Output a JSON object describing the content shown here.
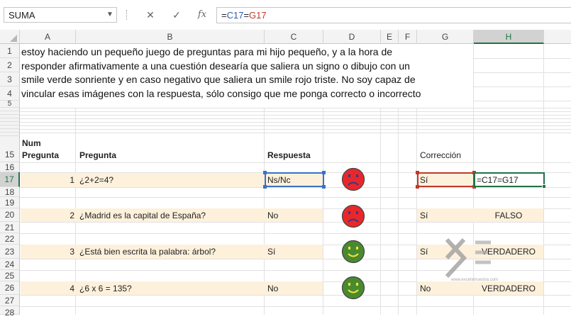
{
  "formula_bar": {
    "name_box": "SUMA",
    "cancel_glyph": "✕",
    "enter_glyph": "✓",
    "function_glyph": "fx",
    "formula_parts": [
      "=",
      "C17",
      "=",
      "G17"
    ]
  },
  "columns": [
    "A",
    "B",
    "C",
    "D",
    "E",
    "F",
    "G",
    "H"
  ],
  "rows": {
    "r1": "1",
    "r2": "2",
    "r3": "3",
    "r4": "4",
    "r5": "5",
    "r15": "15",
    "r16": "16",
    "r17": "17",
    "r18": "18",
    "r19": "19",
    "r20": "20",
    "r21": "21",
    "r22": "22",
    "r23": "23",
    "r24": "24",
    "r25": "25",
    "r26": "26",
    "r27": "27",
    "r28": "28"
  },
  "question_text": {
    "line1": "estoy haciendo un pequeño juego de preguntas para mi hijo pequeño, y a la hora de",
    "line2": "responder afirmativamente a una cuestión desearía que saliera un signo o dibujo con un",
    "line3": "smile verde sonriente y en caso negativo que saliera un smile rojo triste. No soy capaz de",
    "line4": "vincular esas imágenes con la respuesta, sólo consigo que me ponga correcto o incorrecto"
  },
  "headers": {
    "num_line1": "Num",
    "num_line2": "Pregunta",
    "pregunta": "Pregunta",
    "respuesta": "Respuesta",
    "correccion": "Corrección"
  },
  "quiz": [
    {
      "num": "1",
      "question": "¿2+2=4?",
      "answer": "Ns/Nc",
      "correct": "Sí",
      "result": "=C17=G17",
      "face": "red-sad"
    },
    {
      "num": "2",
      "question": "¿Madrid es la capital de España?",
      "answer": "No",
      "correct": "Sí",
      "result": "FALSO",
      "face": "red-sad"
    },
    {
      "num": "3",
      "question": "¿Está bien escrita la palabra: árbol?",
      "answer": "Sí",
      "correct": "Sí",
      "result": "VERDADERO",
      "face": "green-smile"
    },
    {
      "num": "4",
      "question": "¿6 x 6 = 135?",
      "answer": "No",
      "correct": "No",
      "result": "VERDADERO",
      "face": "green-smile"
    }
  ],
  "watermark_text": "www.excelxmuestra.com",
  "colors": {
    "band": "#fdf1dc",
    "accent": "#217346",
    "sad_face": "#e8272b",
    "smile_face": "#4a8a2f",
    "smile_mouth": "#f2e33c"
  }
}
